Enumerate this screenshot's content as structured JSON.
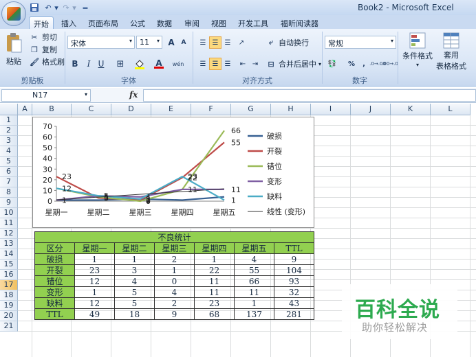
{
  "window": {
    "title": "Book2 - Microsoft Excel"
  },
  "quick_access": {
    "save_icon": "save-icon",
    "undo_icon": "undo-icon",
    "redo_icon": "redo-icon",
    "customize": "="
  },
  "tabs": [
    "开始",
    "插入",
    "页面布局",
    "公式",
    "数据",
    "审阅",
    "视图",
    "开发工具",
    "福昕阅读器"
  ],
  "active_tab": "开始",
  "ribbon": {
    "clipboard": {
      "paste": "粘贴",
      "cut": "剪切",
      "copy": "复制",
      "format_painter": "格式刷",
      "label": "剪贴板"
    },
    "font": {
      "name": "宋体",
      "size": "11",
      "bold": "B",
      "italic": "I",
      "underline": "U",
      "grow": "A",
      "shrink": "A",
      "font_color": "A",
      "phonetic": "wén",
      "label": "字体"
    },
    "alignment": {
      "wrap": "自动换行",
      "merge": "合并后居中",
      "label": "对齐方式"
    },
    "number": {
      "format": "常规",
      "percent": "%",
      "comma": ",",
      "inc_dec": ".00→.0",
      "dec_dec": ".0→.00",
      "label": "数字"
    },
    "styles": {
      "conditional": "条件格式",
      "table_format_1": "套用",
      "table_format_2": "表格格式"
    }
  },
  "formula_bar": {
    "name_box": "N17",
    "fx": "fx",
    "content": ""
  },
  "columns": [
    "A",
    "B",
    "C",
    "D",
    "E",
    "F",
    "G",
    "H",
    "I",
    "J",
    "K",
    "L"
  ],
  "rows": [
    "1",
    "2",
    "3",
    "4",
    "5",
    "6",
    "7",
    "8",
    "9",
    "10",
    "11",
    "12",
    "13",
    "14",
    "15",
    "16",
    "17",
    "18",
    "19",
    "20",
    "21"
  ],
  "selected_row": "17",
  "table": {
    "title": "不良统计",
    "header": [
      "区分",
      "星期一",
      "星期二",
      "星期三",
      "星期四",
      "星期五",
      "TTL"
    ],
    "rows": [
      [
        "破损",
        "1",
        "1",
        "2",
        "1",
        "4",
        "9"
      ],
      [
        "开裂",
        "23",
        "3",
        "1",
        "22",
        "55",
        "104"
      ],
      [
        "错位",
        "12",
        "4",
        "0",
        "11",
        "66",
        "93"
      ],
      [
        "变形",
        "1",
        "5",
        "4",
        "11",
        "11",
        "32"
      ],
      [
        "缺料",
        "12",
        "5",
        "2",
        "23",
        "1",
        "43"
      ],
      [
        "TTL",
        "49",
        "18",
        "9",
        "68",
        "137",
        "281"
      ]
    ]
  },
  "chart_data": {
    "type": "line",
    "categories": [
      "星期一",
      "星期二",
      "星期三",
      "星期四",
      "星期五"
    ],
    "ylim": [
      0,
      70
    ],
    "yticks": [
      "0",
      "10",
      "20",
      "30",
      "40",
      "50",
      "60",
      "70"
    ],
    "legend_position": "right",
    "series": [
      {
        "name": "破损",
        "values": [
          1,
          1,
          2,
          1,
          4
        ],
        "color": "#376092"
      },
      {
        "name": "开裂",
        "values": [
          23,
          3,
          1,
          22,
          55
        ],
        "color": "#be4b48"
      },
      {
        "name": "错位",
        "values": [
          12,
          4,
          0,
          11,
          66
        ],
        "color": "#9bbb59"
      },
      {
        "name": "变形",
        "values": [
          1,
          5,
          4,
          11,
          11
        ],
        "color": "#7f5fa3"
      },
      {
        "name": "缺料",
        "values": [
          12,
          5,
          2,
          23,
          1
        ],
        "color": "#4bacc6"
      }
    ],
    "trendline": {
      "name": "线性 (变形)",
      "color": "#333333"
    },
    "data_labels": [
      {
        "series": 1,
        "index": 0,
        "text": "23"
      },
      {
        "series": 2,
        "index": 0,
        "text": "12"
      },
      {
        "series": 0,
        "index": 0,
        "text": "1"
      },
      {
        "series": 3,
        "index": 1,
        "text": "5"
      },
      {
        "series": 4,
        "index": 1,
        "text": "5"
      },
      {
        "series": 2,
        "index": 1,
        "text": "4"
      },
      {
        "series": 1,
        "index": 1,
        "text": "3"
      },
      {
        "series": 3,
        "index": 2,
        "text": "4"
      },
      {
        "series": 4,
        "index": 2,
        "text": "2"
      },
      {
        "series": 0,
        "index": 2,
        "text": "2"
      },
      {
        "series": 1,
        "index": 2,
        "text": "1"
      },
      {
        "series": 2,
        "index": 2,
        "text": "0"
      },
      {
        "series": 4,
        "index": 3,
        "text": "23"
      },
      {
        "series": 1,
        "index": 3,
        "text": "22"
      },
      {
        "series": 3,
        "index": 3,
        "text": "11"
      },
      {
        "series": 2,
        "index": 4,
        "text": "66"
      },
      {
        "series": 1,
        "index": 4,
        "text": "55"
      },
      {
        "series": 3,
        "index": 4,
        "text": "11"
      },
      {
        "series": 4,
        "index": 4,
        "text": "1"
      }
    ]
  },
  "watermark": {
    "title": "百科全说",
    "subtitle": "助你轻松解决"
  }
}
